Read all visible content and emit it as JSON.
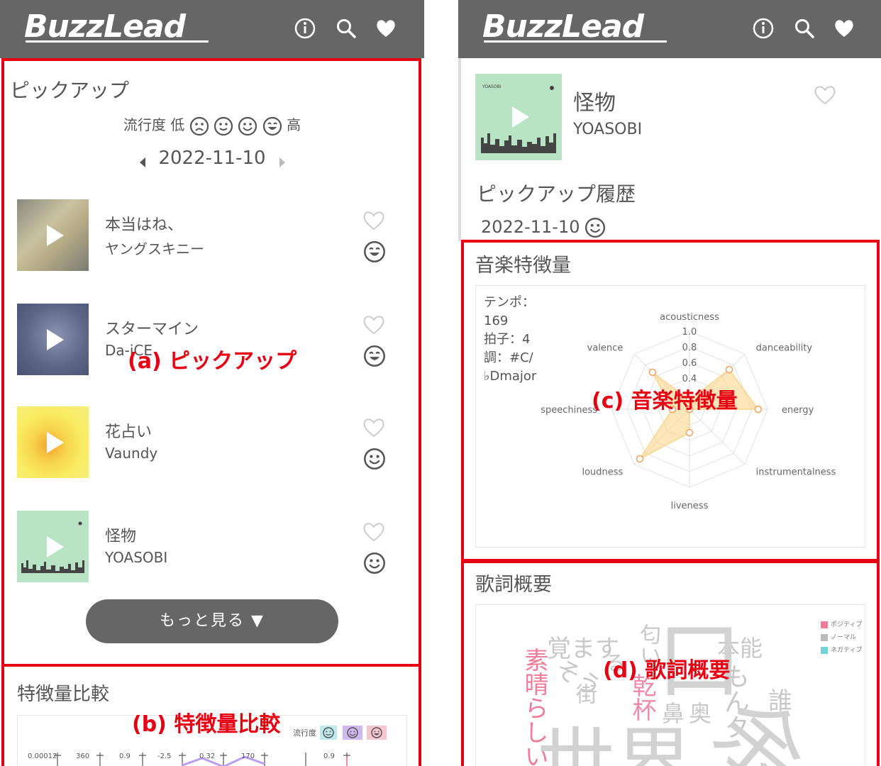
{
  "app": {
    "logo_text": "BuzzLead"
  },
  "colors": {
    "header_bg": "#666666",
    "highlight_red": "#e60012",
    "positive": "#f08ca0",
    "normal": "#bbbbbb",
    "negative": "#7dd8d8",
    "radar_fill": "#fbd58a",
    "radar_point": "#f4a261"
  },
  "icons": [
    "info-icon",
    "search-icon",
    "heart-icon"
  ],
  "left": {
    "pickup": {
      "title": "ピックアップ",
      "legend_prefix": "流行度 低",
      "legend_suffix": "高",
      "date": "2022-11-10",
      "songs": [
        {
          "title": "本当はね、",
          "artist": "ヤングスキニー",
          "face": "happy"
        },
        {
          "title": "スターマイン",
          "artist": "Da-iCE",
          "face": "happy"
        },
        {
          "title": "花占い",
          "artist": "Vaundy",
          "face": "smile"
        },
        {
          "title": "怪物",
          "artist": "YOASOBI",
          "face": "smile"
        }
      ],
      "more_button": "もっと見る ▼"
    },
    "compare": {
      "title": "特徴量比較",
      "legend_label": "流行度",
      "axis_ticks": [
        "0.00012",
        "360",
        "0.9",
        "-2.5",
        "0.32",
        "170",
        "0.9"
      ]
    },
    "annotation_a": "(a) ピックアップ",
    "annotation_b": "(b) 特徴量比較"
  },
  "right": {
    "song": {
      "title": "怪物",
      "artist": "YOASOBI"
    },
    "history": {
      "title": "ピックアップ履歴",
      "date": "2022-11-10"
    },
    "features": {
      "title": "音楽特徴量",
      "tempo_label": "テンポ：",
      "tempo_value": "169",
      "beat": "拍子：4",
      "key_line1": "調：#C/",
      "key_line2": "♭Dmajor"
    },
    "lyrics": {
      "title": "歌詞概要",
      "legend": [
        "ポジティブ",
        "ノーマル",
        "ネガティブ"
      ]
    },
    "annotation_c": "(c) 音楽特徴量",
    "annotation_d": "(d) 歌詞概要"
  },
  "chart_data": {
    "type": "radar",
    "title": "",
    "axes": [
      "acousticness",
      "danceability",
      "energy",
      "instrumentalness",
      "liveness",
      "loudness",
      "speechiness",
      "valence"
    ],
    "ticks": [
      "0.4",
      "0.6",
      "0.8",
      "1.0"
    ],
    "range": [
      0,
      1
    ],
    "values": [
      0.12,
      0.72,
      0.88,
      0.0,
      0.3,
      0.9,
      0.22,
      0.67
    ]
  },
  "wordcloud": [
    {
      "text": "覚ます",
      "class": "normal"
    },
    {
      "text": "本能",
      "class": "normal"
    },
    {
      "text": "口",
      "class": "normal"
    },
    {
      "text": "そう",
      "class": "normal"
    },
    {
      "text": "街",
      "class": "normal"
    },
    {
      "text": "匂い",
      "class": "normal"
    },
    {
      "text": "乾杯",
      "class": "positive"
    },
    {
      "text": "素晴らしい",
      "class": "positive"
    },
    {
      "text": "鼻",
      "class": "normal"
    },
    {
      "text": "奥",
      "class": "normal"
    },
    {
      "text": "誰",
      "class": "normal"
    },
    {
      "text": "もんク",
      "class": "normal"
    },
    {
      "text": "世",
      "class": "normal"
    },
    {
      "text": "界",
      "class": "normal"
    },
    {
      "text": "余",
      "class": "normal"
    },
    {
      "text": "る",
      "class": "normal"
    }
  ]
}
